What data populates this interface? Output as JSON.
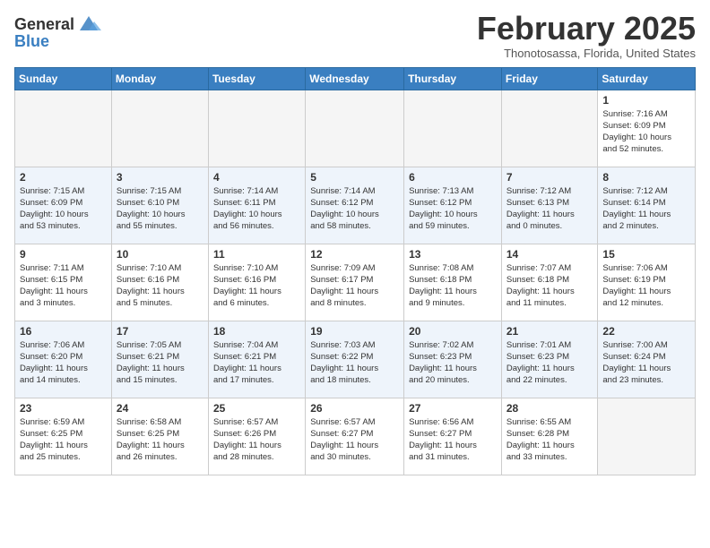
{
  "header": {
    "logo_line1": "General",
    "logo_line2": "Blue",
    "title": "February 2025",
    "location": "Thonotosassa, Florida, United States"
  },
  "days_of_week": [
    "Sunday",
    "Monday",
    "Tuesday",
    "Wednesday",
    "Thursday",
    "Friday",
    "Saturday"
  ],
  "weeks": [
    {
      "cells": [
        {
          "day": "",
          "empty": true
        },
        {
          "day": "",
          "empty": true
        },
        {
          "day": "",
          "empty": true
        },
        {
          "day": "",
          "empty": true
        },
        {
          "day": "",
          "empty": true
        },
        {
          "day": "",
          "empty": true
        },
        {
          "day": "1",
          "info": "Sunrise: 7:16 AM\nSunset: 6:09 PM\nDaylight: 10 hours\nand 52 minutes."
        }
      ]
    },
    {
      "cells": [
        {
          "day": "2",
          "info": "Sunrise: 7:15 AM\nSunset: 6:09 PM\nDaylight: 10 hours\nand 53 minutes."
        },
        {
          "day": "3",
          "info": "Sunrise: 7:15 AM\nSunset: 6:10 PM\nDaylight: 10 hours\nand 55 minutes."
        },
        {
          "day": "4",
          "info": "Sunrise: 7:14 AM\nSunset: 6:11 PM\nDaylight: 10 hours\nand 56 minutes."
        },
        {
          "day": "5",
          "info": "Sunrise: 7:14 AM\nSunset: 6:12 PM\nDaylight: 10 hours\nand 58 minutes."
        },
        {
          "day": "6",
          "info": "Sunrise: 7:13 AM\nSunset: 6:12 PM\nDaylight: 10 hours\nand 59 minutes."
        },
        {
          "day": "7",
          "info": "Sunrise: 7:12 AM\nSunset: 6:13 PM\nDaylight: 11 hours\nand 0 minutes."
        },
        {
          "day": "8",
          "info": "Sunrise: 7:12 AM\nSunset: 6:14 PM\nDaylight: 11 hours\nand 2 minutes."
        }
      ]
    },
    {
      "cells": [
        {
          "day": "9",
          "info": "Sunrise: 7:11 AM\nSunset: 6:15 PM\nDaylight: 11 hours\nand 3 minutes."
        },
        {
          "day": "10",
          "info": "Sunrise: 7:10 AM\nSunset: 6:16 PM\nDaylight: 11 hours\nand 5 minutes."
        },
        {
          "day": "11",
          "info": "Sunrise: 7:10 AM\nSunset: 6:16 PM\nDaylight: 11 hours\nand 6 minutes."
        },
        {
          "day": "12",
          "info": "Sunrise: 7:09 AM\nSunset: 6:17 PM\nDaylight: 11 hours\nand 8 minutes."
        },
        {
          "day": "13",
          "info": "Sunrise: 7:08 AM\nSunset: 6:18 PM\nDaylight: 11 hours\nand 9 minutes."
        },
        {
          "day": "14",
          "info": "Sunrise: 7:07 AM\nSunset: 6:18 PM\nDaylight: 11 hours\nand 11 minutes."
        },
        {
          "day": "15",
          "info": "Sunrise: 7:06 AM\nSunset: 6:19 PM\nDaylight: 11 hours\nand 12 minutes."
        }
      ]
    },
    {
      "cells": [
        {
          "day": "16",
          "info": "Sunrise: 7:06 AM\nSunset: 6:20 PM\nDaylight: 11 hours\nand 14 minutes."
        },
        {
          "day": "17",
          "info": "Sunrise: 7:05 AM\nSunset: 6:21 PM\nDaylight: 11 hours\nand 15 minutes."
        },
        {
          "day": "18",
          "info": "Sunrise: 7:04 AM\nSunset: 6:21 PM\nDaylight: 11 hours\nand 17 minutes."
        },
        {
          "day": "19",
          "info": "Sunrise: 7:03 AM\nSunset: 6:22 PM\nDaylight: 11 hours\nand 18 minutes."
        },
        {
          "day": "20",
          "info": "Sunrise: 7:02 AM\nSunset: 6:23 PM\nDaylight: 11 hours\nand 20 minutes."
        },
        {
          "day": "21",
          "info": "Sunrise: 7:01 AM\nSunset: 6:23 PM\nDaylight: 11 hours\nand 22 minutes."
        },
        {
          "day": "22",
          "info": "Sunrise: 7:00 AM\nSunset: 6:24 PM\nDaylight: 11 hours\nand 23 minutes."
        }
      ]
    },
    {
      "cells": [
        {
          "day": "23",
          "info": "Sunrise: 6:59 AM\nSunset: 6:25 PM\nDaylight: 11 hours\nand 25 minutes."
        },
        {
          "day": "24",
          "info": "Sunrise: 6:58 AM\nSunset: 6:25 PM\nDaylight: 11 hours\nand 26 minutes."
        },
        {
          "day": "25",
          "info": "Sunrise: 6:57 AM\nSunset: 6:26 PM\nDaylight: 11 hours\nand 28 minutes."
        },
        {
          "day": "26",
          "info": "Sunrise: 6:57 AM\nSunset: 6:27 PM\nDaylight: 11 hours\nand 30 minutes."
        },
        {
          "day": "27",
          "info": "Sunrise: 6:56 AM\nSunset: 6:27 PM\nDaylight: 11 hours\nand 31 minutes."
        },
        {
          "day": "28",
          "info": "Sunrise: 6:55 AM\nSunset: 6:28 PM\nDaylight: 11 hours\nand 33 minutes."
        },
        {
          "day": "",
          "empty": true
        }
      ]
    }
  ]
}
